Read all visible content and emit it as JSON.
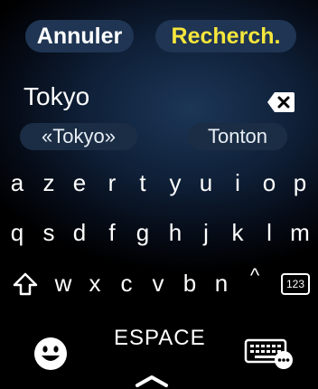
{
  "top": {
    "cancel_label": "Annuler",
    "search_label": "Recherch."
  },
  "field": {
    "value": "Tokyo"
  },
  "suggestions": [
    "«Tokyo»",
    "Tonton"
  ],
  "keyboard": {
    "row1": [
      "a",
      "z",
      "e",
      "r",
      "t",
      "y",
      "u",
      "i",
      "o",
      "p"
    ],
    "row2": [
      "q",
      "s",
      "d",
      "f",
      "g",
      "h",
      "j",
      "k",
      "l",
      "m"
    ],
    "row3": [
      "w",
      "x",
      "c",
      "v",
      "b",
      "n",
      "^"
    ],
    "numbers_label": "123",
    "space_label": "ESPACE"
  },
  "icons": [
    "delete-icon",
    "shift-icon",
    "emoji-icon",
    "keyboard-icon",
    "grabber-icon"
  ],
  "colors": {
    "accent": "#f5e63c",
    "pill": "#1f3553",
    "suggestion": "#1b2d44"
  }
}
